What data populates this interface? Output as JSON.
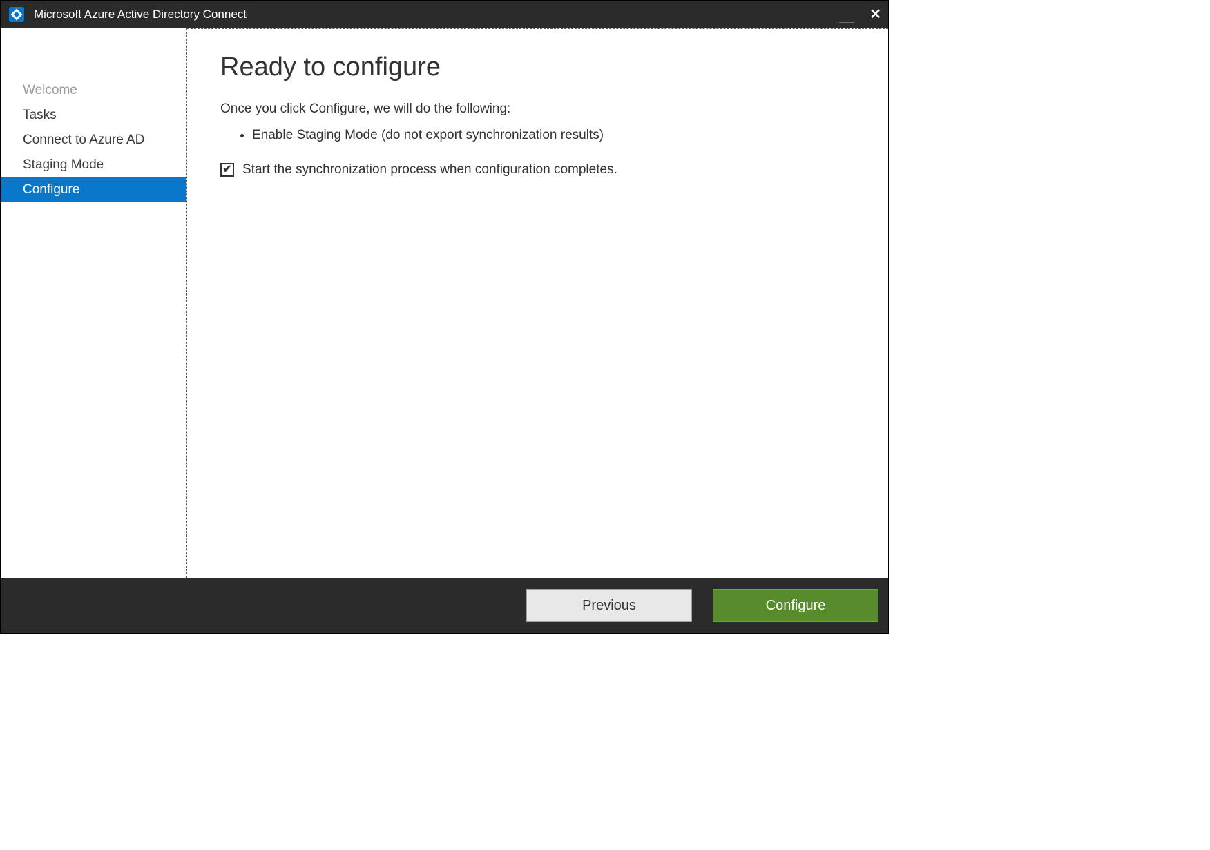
{
  "window": {
    "title": "Microsoft Azure Active Directory Connect"
  },
  "sidebar": {
    "items": [
      {
        "label": "Welcome",
        "state": "disabled"
      },
      {
        "label": "Tasks",
        "state": "normal"
      },
      {
        "label": "Connect to Azure AD",
        "state": "normal"
      },
      {
        "label": "Staging Mode",
        "state": "normal"
      },
      {
        "label": "Configure",
        "state": "active"
      }
    ]
  },
  "main": {
    "heading": "Ready to configure",
    "intro": "Once you click Configure, we will do the following:",
    "actions": [
      "Enable Staging Mode (do not export synchronization results)"
    ],
    "checkbox": {
      "checked": true,
      "label": "Start the synchronization process when configuration completes."
    }
  },
  "footer": {
    "previous": "Previous",
    "configure": "Configure"
  }
}
